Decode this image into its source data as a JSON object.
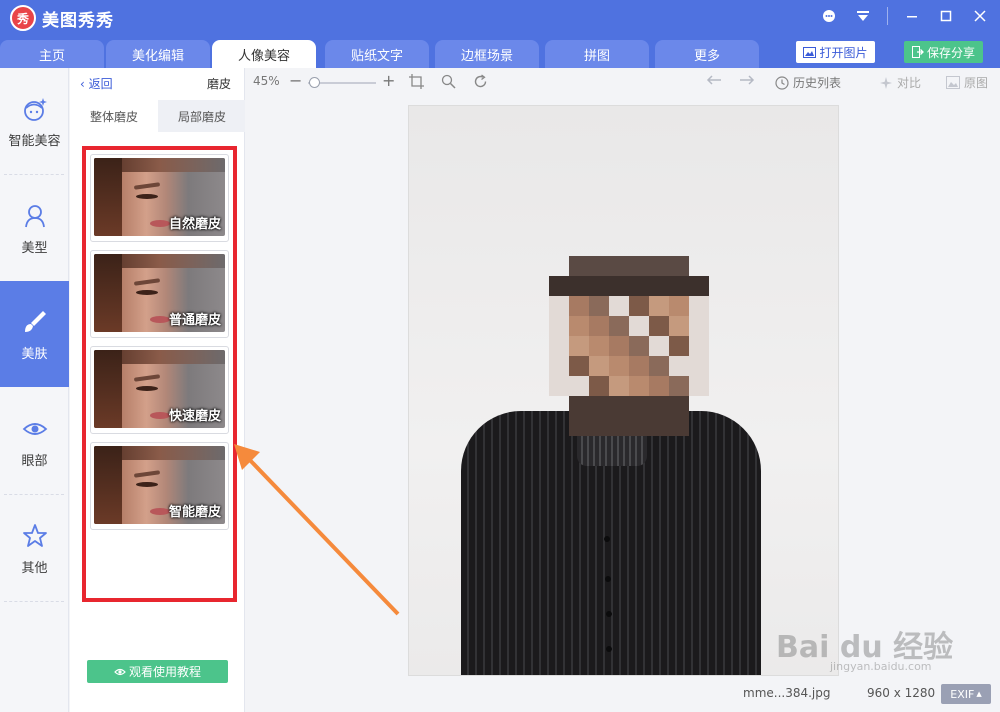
{
  "app": {
    "logo_glyph": "秀",
    "title": "美图秀秀"
  },
  "window_controls": [
    "chat-icon",
    "menu-dropdown-icon",
    "minimize-icon",
    "maximize-icon",
    "close-icon"
  ],
  "tabs": [
    {
      "label": "主页",
      "active": false
    },
    {
      "label": "美化编辑",
      "active": false
    },
    {
      "label": "人像美容",
      "active": true
    },
    {
      "label": "贴纸文字",
      "active": false
    },
    {
      "label": "边框场景",
      "active": false
    },
    {
      "label": "拼图",
      "active": false
    },
    {
      "label": "更多",
      "active": false
    }
  ],
  "header_buttons": {
    "open": "打开图片",
    "save": "保存分享"
  },
  "leftnav": [
    {
      "label": "智能美容",
      "icon": "face-sparkle-icon",
      "active": false
    },
    {
      "label": "美型",
      "icon": "person-icon",
      "active": false
    },
    {
      "label": "美肤",
      "icon": "brush-icon",
      "active": true
    },
    {
      "label": "眼部",
      "icon": "eye-icon",
      "active": false
    },
    {
      "label": "其他",
      "icon": "star-icon",
      "active": false
    }
  ],
  "panel": {
    "back": "返回",
    "title": "磨皮",
    "subtabs": [
      {
        "label": "整体磨皮",
        "active": true
      },
      {
        "label": "局部磨皮",
        "active": false
      }
    ],
    "presets": [
      "自然磨皮",
      "普通磨皮",
      "快速磨皮",
      "智能磨皮"
    ],
    "tutorial": "观看使用教程"
  },
  "toolbar": {
    "zoom": "45%",
    "history": "历史列表",
    "compare": "对比",
    "original": "原图"
  },
  "status": {
    "filename": "mme...384.jpg",
    "dimensions": "960 x 1280",
    "exif": "EXIF"
  },
  "watermark": {
    "brand": "Bai du 经验",
    "url": "jingyan.baidu.com"
  },
  "colors": {
    "primary": "#4f72e0",
    "active_nav": "#5b7de6",
    "green": "#4cc48b",
    "highlight_box": "#e8262f",
    "arrow": "#f58a3c"
  }
}
